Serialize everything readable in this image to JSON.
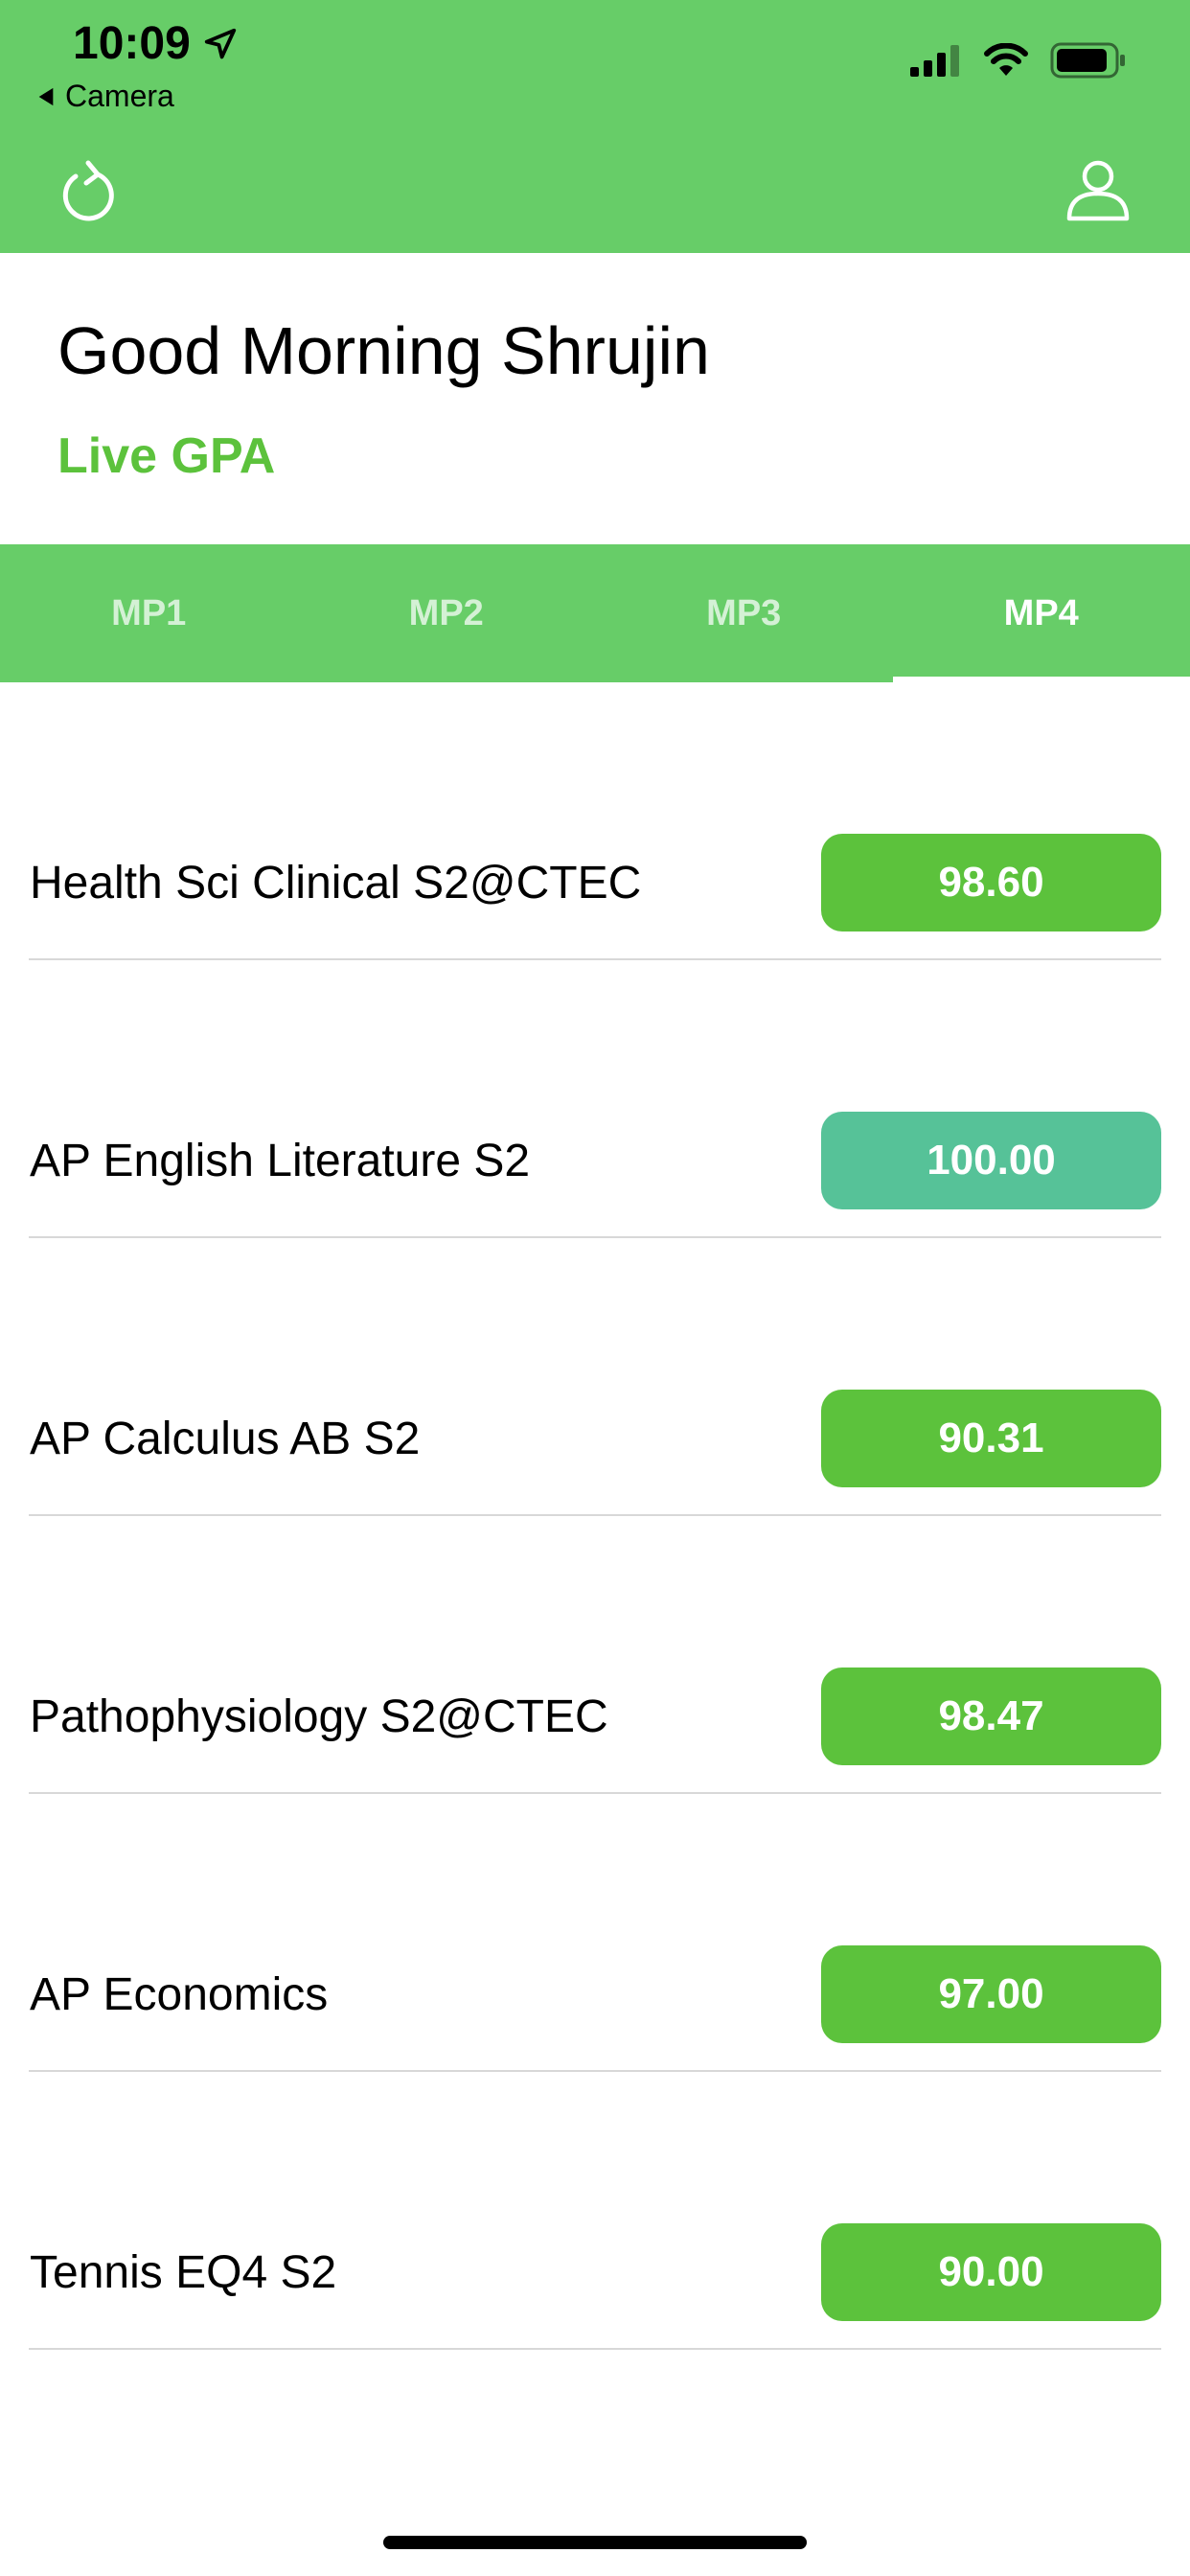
{
  "status_bar": {
    "time": "10:09",
    "back_app_label": "Camera"
  },
  "nav": {
    "refresh_icon": "refresh-icon",
    "profile_icon": "user-icon"
  },
  "greeting": "Good Morning Shrujin",
  "subtitle": "Live GPA",
  "tabs": [
    {
      "label": "MP1",
      "active": false
    },
    {
      "label": "MP2",
      "active": false
    },
    {
      "label": "MP3",
      "active": false
    },
    {
      "label": "MP4",
      "active": true
    }
  ],
  "courses": [
    {
      "name": "Health Sci Clinical S2@CTEC",
      "grade": "98.60",
      "color": "#5cc23c"
    },
    {
      "name": "AP English Literature S2",
      "grade": "100.00",
      "color": "#56c298"
    },
    {
      "name": "AP Calculus AB S2",
      "grade": "90.31",
      "color": "#5cc23c"
    },
    {
      "name": "Pathophysiology S2@CTEC",
      "grade": "98.47",
      "color": "#5cc23c"
    },
    {
      "name": "AP Economics",
      "grade": "97.00",
      "color": "#5cc23c"
    },
    {
      "name": "Tennis EQ4 S2",
      "grade": "90.00",
      "color": "#5cc23c"
    }
  ],
  "colors": {
    "header": "#67cd68",
    "accent": "#5cc23c"
  }
}
